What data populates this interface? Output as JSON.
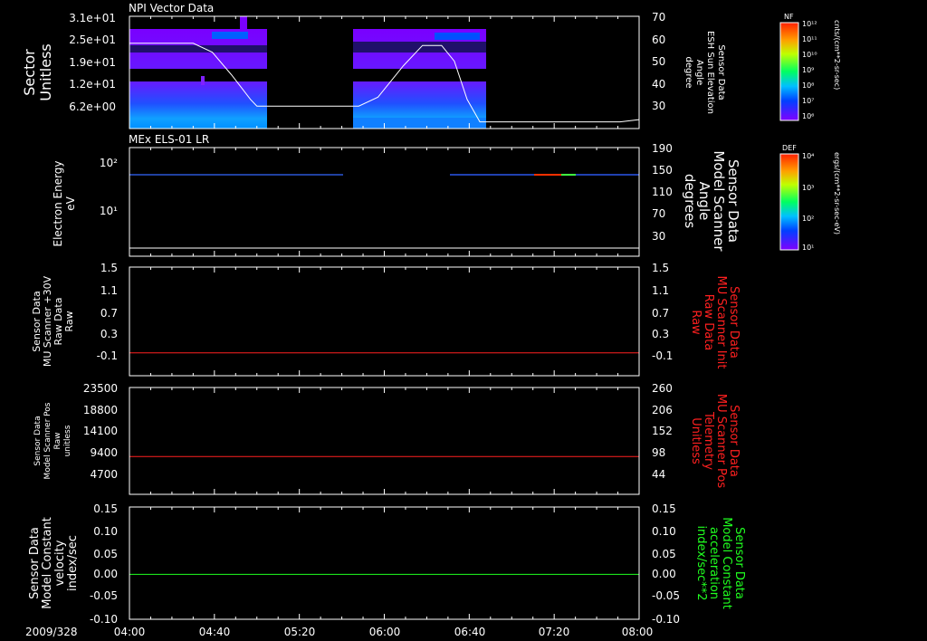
{
  "footer": {
    "date": "2009/328"
  },
  "x_axis": {
    "ticks": [
      "04:00",
      "04:40",
      "05:20",
      "06:00",
      "06:40",
      "07:20",
      "08:00"
    ],
    "range_hours": [
      4.0,
      8.0
    ]
  },
  "colorbars": [
    {
      "name": "npi-colorbar",
      "header": "NF",
      "unit": "cnts/(cm**2-sr-sec)",
      "tick_labels": [
        "10¹²",
        "10¹¹",
        "10¹⁰",
        "10⁹",
        "10⁸",
        "10⁷",
        "10⁶"
      ]
    },
    {
      "name": "els-colorbar",
      "header": "DEF",
      "unit": "ergs/(cm**2-sr-sec-eV)",
      "tick_labels": [
        "10⁴",
        "10³",
        "10²",
        "10¹"
      ]
    }
  ],
  "chart_data": [
    {
      "type": "heatmap",
      "title": "NPI Vector Data",
      "ylabel_left": [
        "Sector",
        "Unitless"
      ],
      "ylabel_right": [
        "Sensor Data",
        "ESH Sun Elevation",
        "Angle",
        "degree"
      ],
      "left_ticks": [
        "3.1e+01",
        "2.5e+01",
        "1.9e+01",
        "1.2e+01",
        "6.2e+00"
      ],
      "right_ticks": [
        "70",
        "60",
        "50",
        "40",
        "30"
      ],
      "ylim_right": [
        20,
        70
      ],
      "data_intervals": [
        [
          4.0,
          5.1
        ],
        [
          5.8,
          6.65
        ]
      ],
      "line_series": {
        "name": "ESH Sun Elevation Angle",
        "x": [
          4.0,
          4.5,
          4.65,
          4.8,
          4.95,
          5.0,
          5.5,
          5.8,
          5.95,
          6.15,
          6.3,
          6.45,
          6.55,
          6.65,
          6.75,
          7.5,
          7.85,
          8.0
        ],
        "y": [
          58,
          58,
          54,
          44,
          33,
          30,
          30,
          30,
          34,
          48,
          57,
          57,
          50,
          33,
          23,
          23,
          23,
          24
        ]
      }
    },
    {
      "type": "heatmap",
      "title": "MEx ELS-01 LR",
      "ylabel_left": [
        "Electron Energy",
        "eV"
      ],
      "ylabel_right": [
        "Sensor Data",
        "Model Scanner",
        "Angle",
        "degrees"
      ],
      "left_ticks": [
        "10²",
        "10¹"
      ],
      "right_ticks": [
        "190",
        "150",
        "110",
        "70",
        "30"
      ],
      "ylim_right": [
        10,
        190
      ],
      "band_energy_eV": 60,
      "data_intervals": [
        [
          4.0,
          5.6
        ],
        [
          6.45,
          8.0
        ]
      ],
      "line_series": {
        "name": "Model Scanner Angle",
        "x": [
          4.0,
          8.0
        ],
        "y": [
          10,
          10
        ]
      }
    },
    {
      "type": "line",
      "ylabel_left": [
        "Sensor Data",
        "MU Scanner +30V",
        "Raw Data",
        "Raw"
      ],
      "ylabel_right": [
        "Sensor Data",
        "MU Scanner Init",
        "Raw Data",
        "Raw"
      ],
      "left_ticks": [
        "1.5",
        "1.1",
        "0.7",
        "0.3",
        "-0.1"
      ],
      "right_ticks": [
        "1.5",
        "1.1",
        "0.7",
        "0.3",
        "-0.1"
      ],
      "ylim": [
        -0.4,
        1.5
      ],
      "series": [
        {
          "x": [
            4.0,
            8.0
          ],
          "y": [
            0.0,
            0.0
          ],
          "color": "#ff2020"
        }
      ]
    },
    {
      "type": "line",
      "ylabel_left": [
        "Sensor Data",
        "Model Scanner Pos",
        "Raw",
        "unitless"
      ],
      "ylabel_right": [
        "Sensor Data",
        "MU Scanner Pos",
        "Telemetry",
        "Unitless"
      ],
      "left_ticks": [
        "23500",
        "18800",
        "14100",
        "9400",
        "4700"
      ],
      "right_ticks": [
        "260",
        "206",
        "152",
        "98",
        "44"
      ],
      "ylim": [
        0,
        23500
      ],
      "series": [
        {
          "x": [
            4.0,
            8.0
          ],
          "y": [
            8300,
            8300
          ],
          "color": "#ff2020"
        }
      ]
    },
    {
      "type": "line",
      "ylabel_left": [
        "Sensor Data",
        "Model Constant",
        "velocity",
        "index/sec"
      ],
      "ylabel_right": [
        "Sensor Data",
        "Model Constant",
        "acceleration",
        "index/sec**2"
      ],
      "left_ticks": [
        "0.15",
        "0.10",
        "0.05",
        "0.00",
        "-0.05",
        "-0.10"
      ],
      "right_ticks": [
        "0.15",
        "0.10",
        "0.05",
        "0.00",
        "-0.05",
        "-0.10"
      ],
      "ylim": [
        -0.1,
        0.15
      ],
      "series": [
        {
          "x": [
            4.0,
            8.0
          ],
          "y": [
            0.0,
            0.0
          ],
          "color": "#20ff20"
        }
      ]
    }
  ]
}
